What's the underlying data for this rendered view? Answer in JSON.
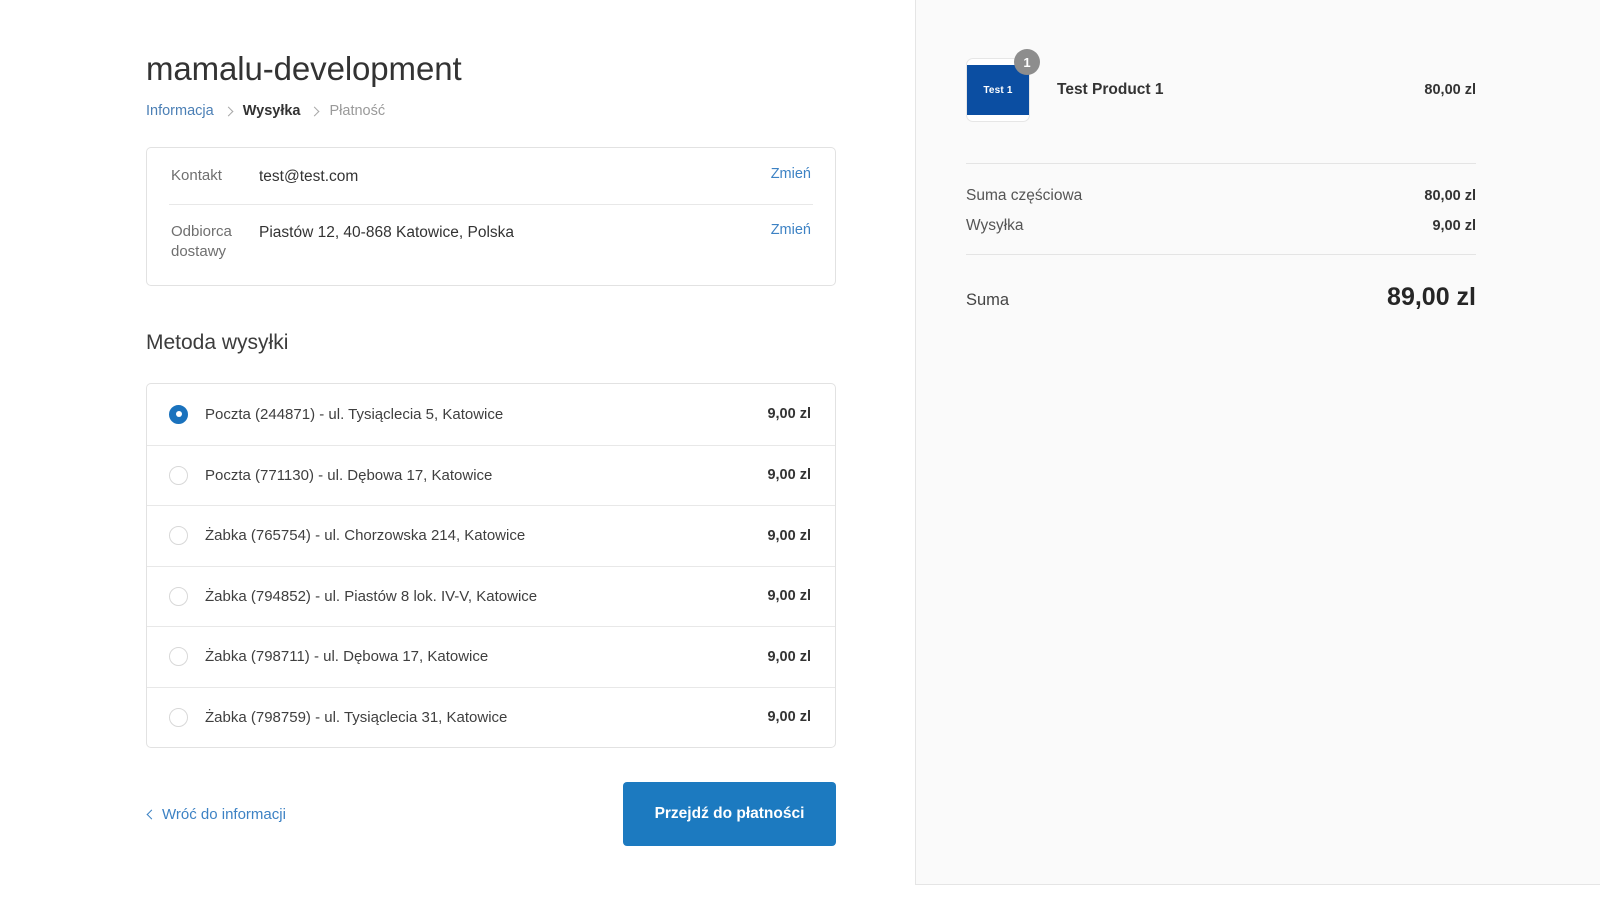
{
  "shop": {
    "title": "mamalu-development"
  },
  "breadcrumb": {
    "information": "Informacja",
    "shipping": "Wysyłka",
    "payment": "Płatność"
  },
  "contact_card": {
    "contact_label": "Kontakt",
    "contact_value": "test@test.com",
    "contact_change": "Zmień",
    "address_label": "Odbiorca dostawy",
    "address_value": "Piastów 12, 40-868 Katowice, Polska",
    "address_change": "Zmień"
  },
  "shipping": {
    "heading": "Metoda wysyłki",
    "options": [
      {
        "label": "Poczta (244871) - ul. Tysiąclecia 5, Katowice",
        "price": "9,00 zl",
        "selected": true
      },
      {
        "label": "Poczta (771130) - ul. Dębowa 17, Katowice",
        "price": "9,00 zl",
        "selected": false
      },
      {
        "label": "Żabka (765754) - ul. Chorzowska 214, Katowice",
        "price": "9,00 zl",
        "selected": false
      },
      {
        "label": "Żabka (794852) - ul. Piastów 8 lok. IV-V, Katowice",
        "price": "9,00 zl",
        "selected": false
      },
      {
        "label": "Żabka (798711) - ul. Dębowa 17, Katowice",
        "price": "9,00 zl",
        "selected": false
      },
      {
        "label": "Żabka (798759) - ul. Tysiąclecia 31, Katowice",
        "price": "9,00 zl",
        "selected": false
      }
    ]
  },
  "actions": {
    "back_label": "Wróć do informacji",
    "pay_label": "Przejdź do płatności"
  },
  "summary": {
    "item": {
      "thumb_text": "Test 1",
      "quantity": "1",
      "name": "Test Product 1",
      "price": "80,00 zl"
    },
    "subtotal_label": "Suma częściowa",
    "subtotal_value": "80,00 zl",
    "shipping_label": "Wysyłka",
    "shipping_value": "9,00 zl",
    "total_label": "Suma",
    "total_value": "89,00 zl"
  },
  "colors": {
    "accent_blue": "#1c7ac0",
    "link_blue": "#3d82c4",
    "thumb_blue": "#0b4ea2",
    "badge_grey": "#8d8d8d",
    "sidebar_bg": "#fafafa"
  }
}
